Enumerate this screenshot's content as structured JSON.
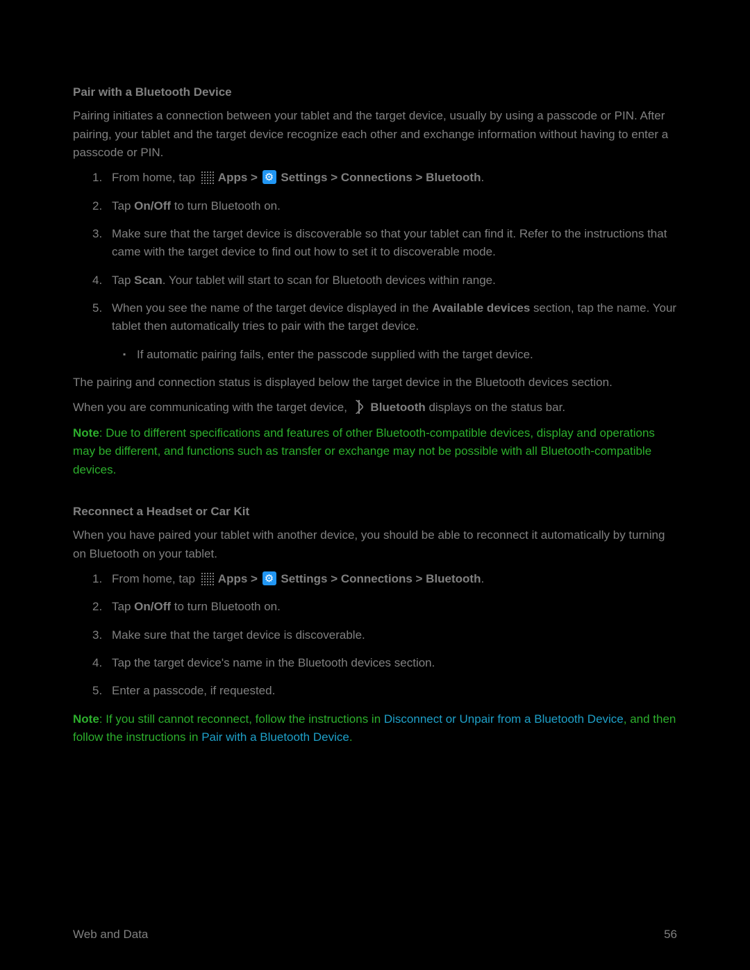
{
  "section1": {
    "heading": "Pair with a Bluetooth Device",
    "intro": "Pairing initiates a connection between your tablet and the target device, usually by using a passcode or PIN. After pairing, your tablet and the target device recognize each other and exchange information without having to enter a passcode or PIN.",
    "step1_a": "From home, tap ",
    "apps_label": " Apps",
    "gt_settings": " > ",
    "settings_tail": " Settings > Connections > Bluetooth",
    "period": ".",
    "step2_a": "Tap ",
    "step2_b": "On/Off",
    "step2_c": " to turn Bluetooth on.",
    "step3": "Make sure that the target device is discoverable so that your tablet can find it. Refer to the instructions that came with the target device to find out how to set it to discoverable mode.",
    "step4_a": "Tap ",
    "step4_b": "Scan",
    "step4_c": ". Your tablet will start to scan for Bluetooth devices within range.",
    "step5_a": "When you see the name of the target device displayed in the ",
    "step5_b": "Available devices",
    "step5_c": " section, tap the name. Your tablet then automatically tries to pair with the target device.",
    "step5_sub": "If automatic pairing fails, enter the passcode supplied with the target device.",
    "para_after1": "The pairing and connection status is displayed below the target device in the Bluetooth devices section.",
    "comm_a": "When you are communicating with the target device, ",
    "comm_bt": " Bluetooth",
    "comm_c": " displays on the status bar.",
    "note_label": "Note",
    "note_body": ": Due to different specifications and features of other Bluetooth-compatible devices, display and operations may be different, and functions such as transfer or exchange may not be possible with all Bluetooth-compatible devices."
  },
  "section2": {
    "heading": "Reconnect a Headset or Car Kit",
    "intro": "When you have paired your tablet with another device, you should be able to reconnect it automatically by turning on Bluetooth on your tablet.",
    "step1_a": "From home, tap ",
    "apps_label": " Apps",
    "gt": " > ",
    "settings_tail": " Settings > Connections > Bluetooth",
    "period": ".",
    "step2_a": "Tap ",
    "step2_b": "On/Off",
    "step2_c": " to turn Bluetooth on.",
    "step3": "Make sure that the target device is discoverable.",
    "step4": "Tap the target device's name in the Bluetooth devices section.",
    "step5": "Enter a passcode, if requested.",
    "note_label": "Note",
    "note_a": ": If you still cannot reconnect, follow the instructions in ",
    "note_link1": "Disconnect or Unpair from a Bluetooth Device",
    "note_b": ", and then follow the instructions in ",
    "note_link2": "Pair with a Bluetooth Device",
    "note_c": "."
  },
  "footer": {
    "left": "Web and Data",
    "right": "56"
  }
}
